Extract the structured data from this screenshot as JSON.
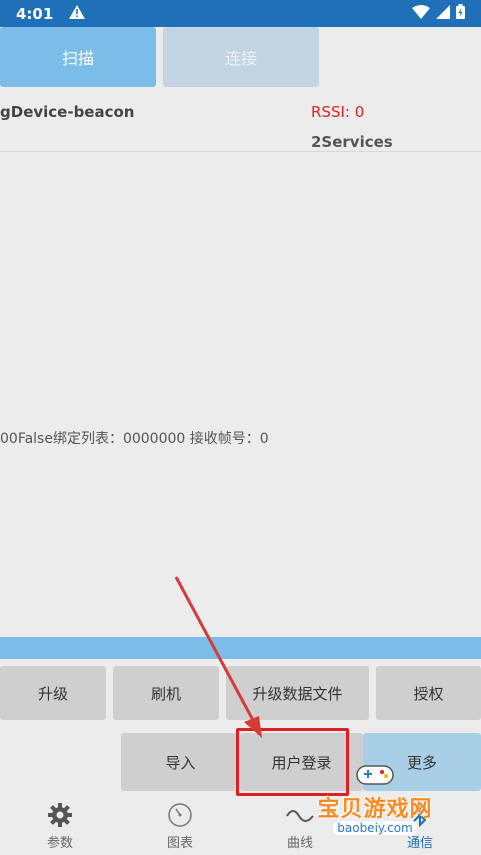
{
  "status_bar": {
    "time": "4:01",
    "warning_icon": "warning-triangle-icon",
    "wifi_icon": "wifi-icon",
    "signal_icon": "signal-icon",
    "battery_icon": "battery-icon"
  },
  "top_buttons": {
    "scan": "扫描",
    "connect": "连接"
  },
  "device": {
    "name": "gDevice-beacon",
    "rssi": "RSSI: 0",
    "services": "2Services"
  },
  "bind_info": "00False绑定列表：0000000  接收帧号：0",
  "action_buttons": {
    "upgrade": "升级",
    "flash": "刷机",
    "upgrade_data_file": "升级数据文件",
    "authorize": "授权",
    "import": "导入",
    "user_login": "用户登录",
    "more": "更多"
  },
  "tabs": [
    {
      "label": "参数",
      "icon": "gear-icon"
    },
    {
      "label": "图表",
      "icon": "gauge-icon"
    },
    {
      "label": "曲线",
      "icon": "wave-icon"
    },
    {
      "label": "通信",
      "icon": "bluetooth-icon"
    }
  ],
  "watermark": {
    "title": "宝贝游戏网",
    "url": "baobeiy.com"
  },
  "colors": {
    "status_bar": "#1f6fb9",
    "primary_button": "#7bbce9",
    "disabled_button": "#c3d4e2",
    "annotation_red": "#e02020",
    "rssi_red": "#e02020"
  }
}
